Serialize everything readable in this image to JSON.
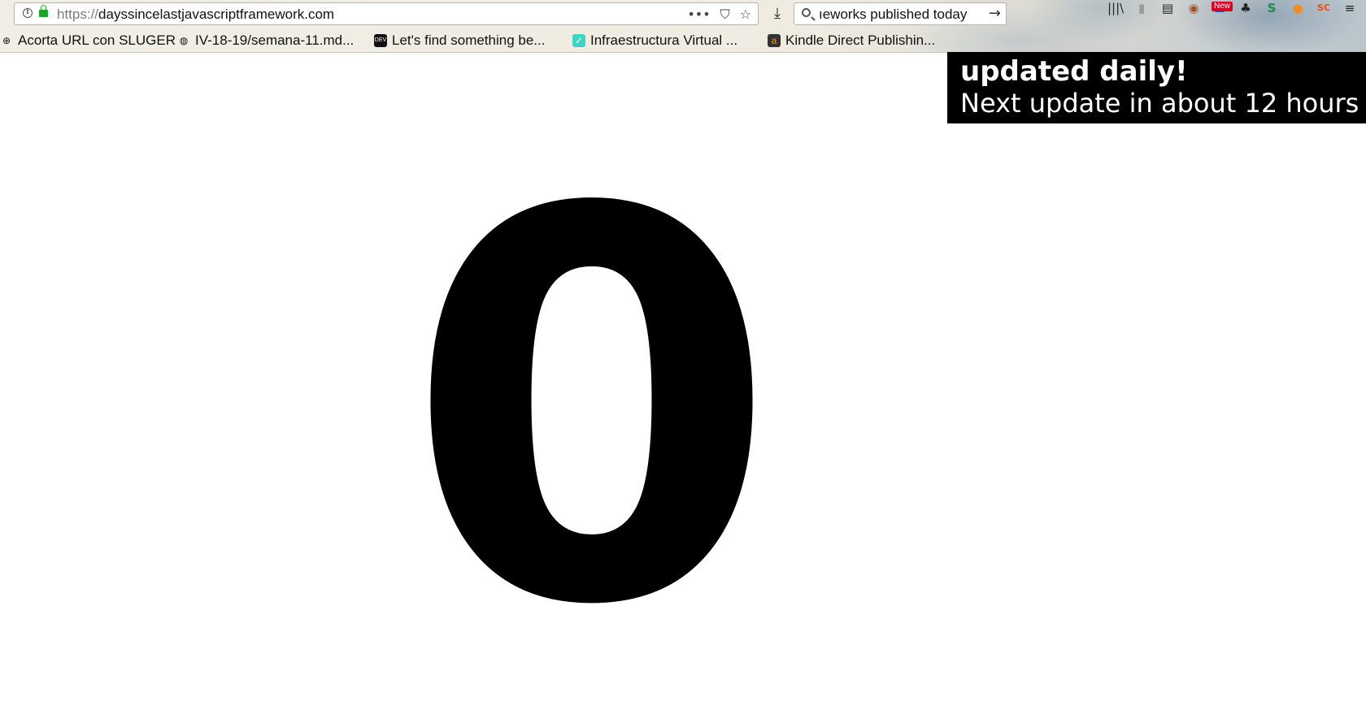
{
  "browser": {
    "url_scheme": "https://",
    "url_host": "dayssincelastjavascriptframework.com",
    "url_actions": [
      "•••",
      "⛉",
      "☆"
    ],
    "search_text": "ıeworks published today",
    "toolbar_badge": "New",
    "toolbar_icons": [
      "library-icon",
      "tab-icon",
      "reader-icon",
      "monkey-icon",
      "extension-icon",
      "paw-icon",
      "s-icon",
      "s-orange-icon",
      "sc-icon",
      "menu-icon"
    ]
  },
  "bookmarks": [
    {
      "label": "Acorta URL con SLUGER",
      "icon": "globe-icon"
    },
    {
      "label": "IV-18-19/semana-11.md...",
      "icon": "github-icon"
    },
    {
      "label": "Let's find something be...",
      "icon": "dev-icon"
    },
    {
      "label": "Infraestructura Virtual ...",
      "icon": "slack-icon"
    },
    {
      "label": "Kindle Direct Publishin...",
      "icon": "amazon-icon"
    }
  ],
  "banner": {
    "line1": "updated daily!",
    "line2": "Next update in about 12 hours"
  },
  "main": {
    "days_since": "0"
  }
}
